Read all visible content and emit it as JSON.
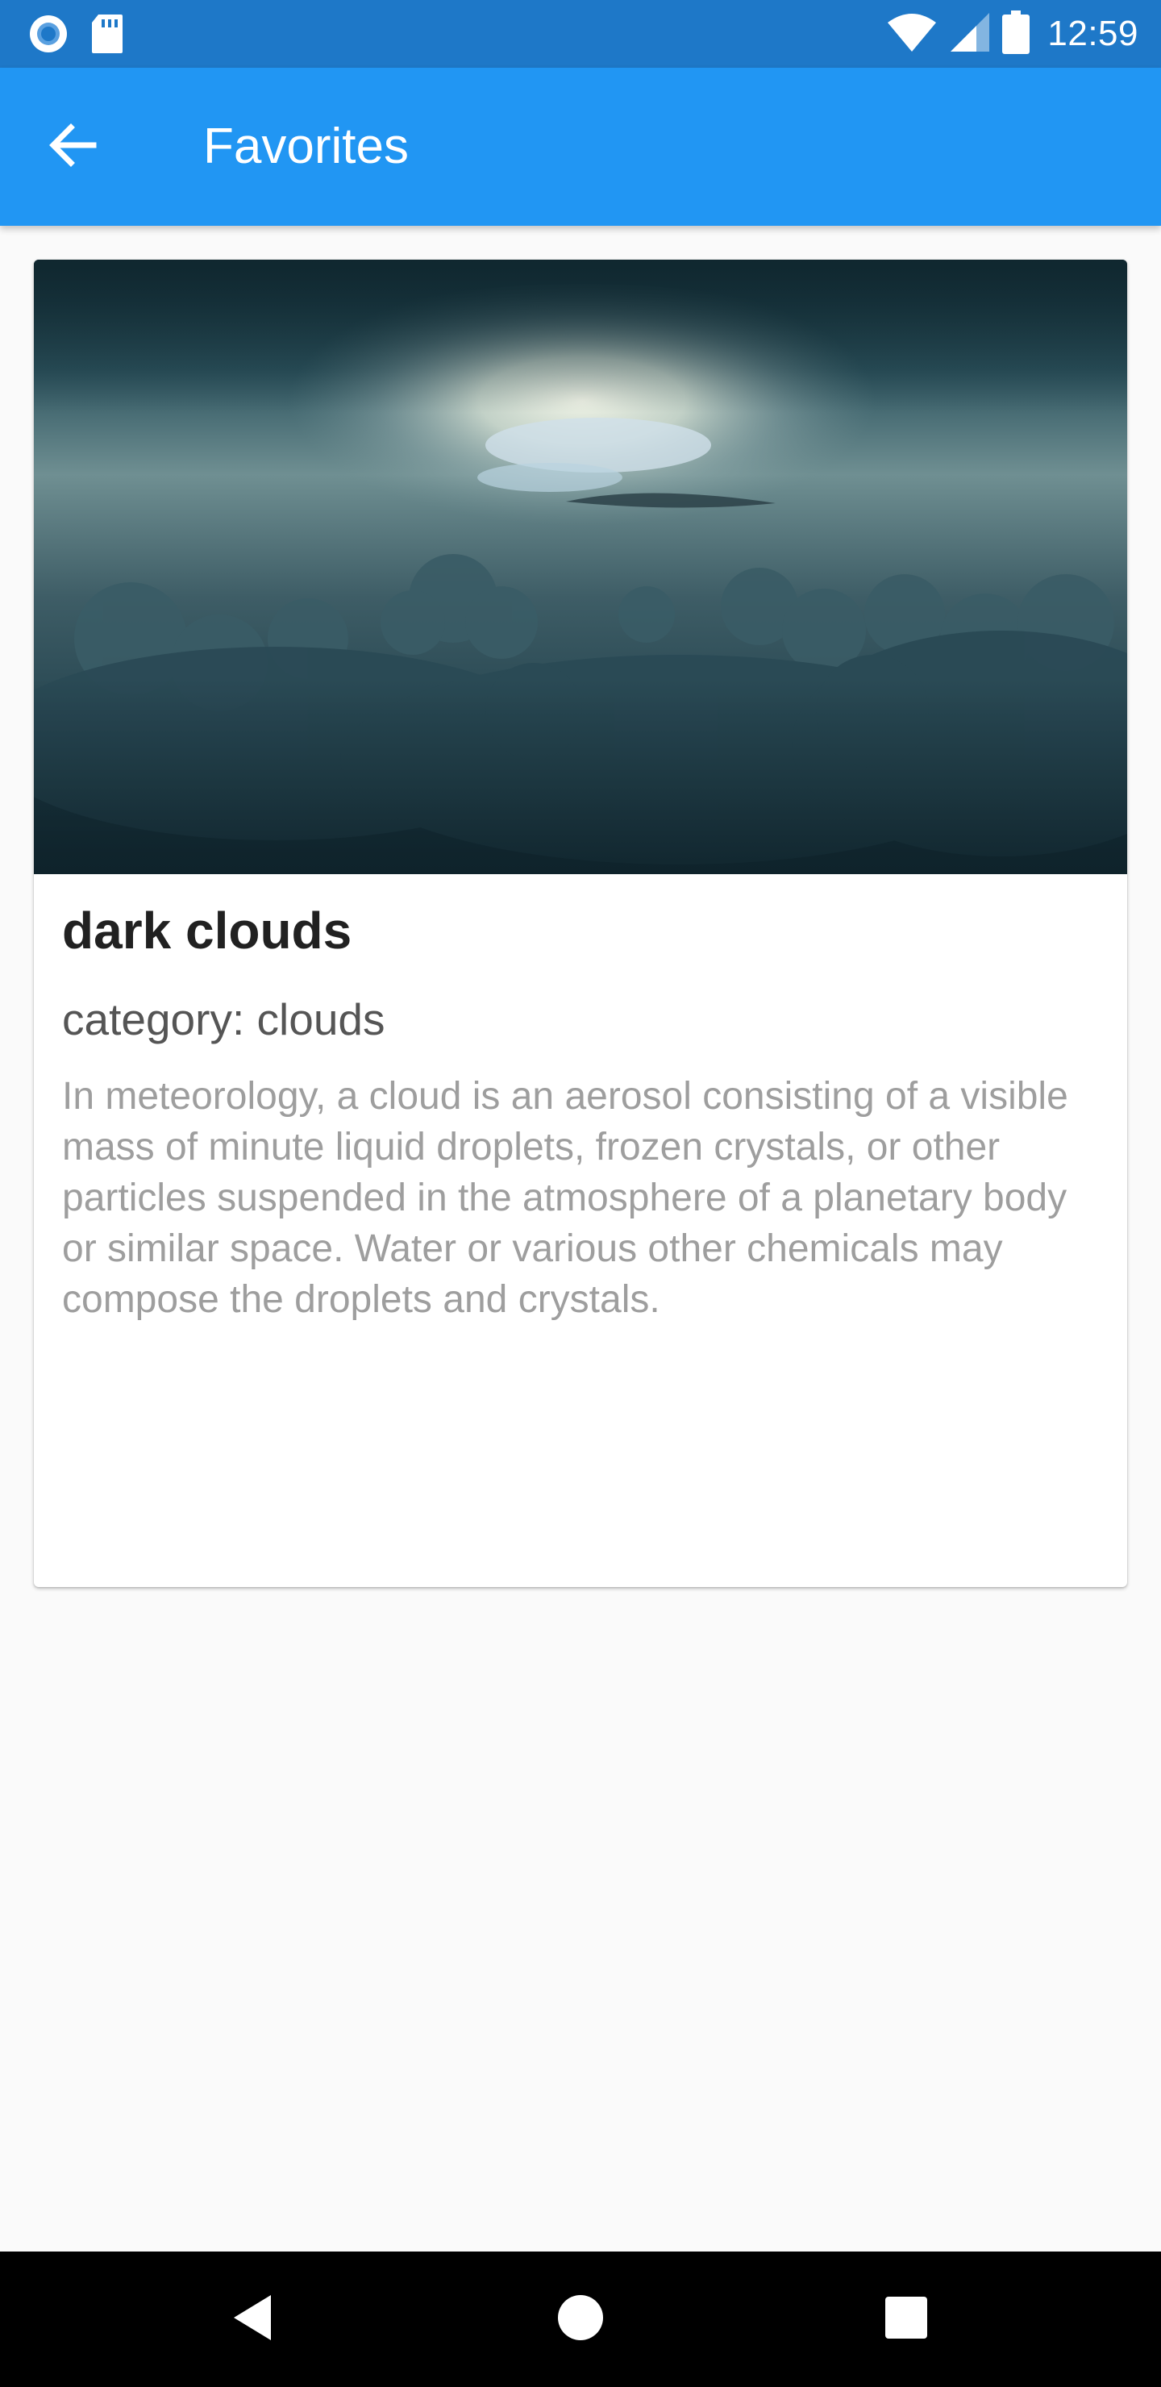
{
  "status_bar": {
    "time": "12:59",
    "icons": [
      "notification-circle-icon",
      "sd-card-icon",
      "wifi-icon",
      "cell-signal-icon",
      "battery-icon"
    ]
  },
  "app_bar": {
    "title": "Favorites",
    "back_icon": "arrow-back-icon",
    "color": "#2196f3"
  },
  "favorite_card": {
    "image": "dark-clouds-photo",
    "title": "dark clouds",
    "category": "category: clouds",
    "description": "In meteorology, a cloud is an aerosol consisting of a visible mass of minute liquid droplets, frozen crystals, or other particles suspended in the atmosphere of a planetary body or similar space. Water or various other chemicals may compose the droplets and crystals."
  },
  "nav_bar": {
    "buttons": [
      "back-triangle-icon",
      "home-circle-icon",
      "recents-square-icon"
    ]
  }
}
